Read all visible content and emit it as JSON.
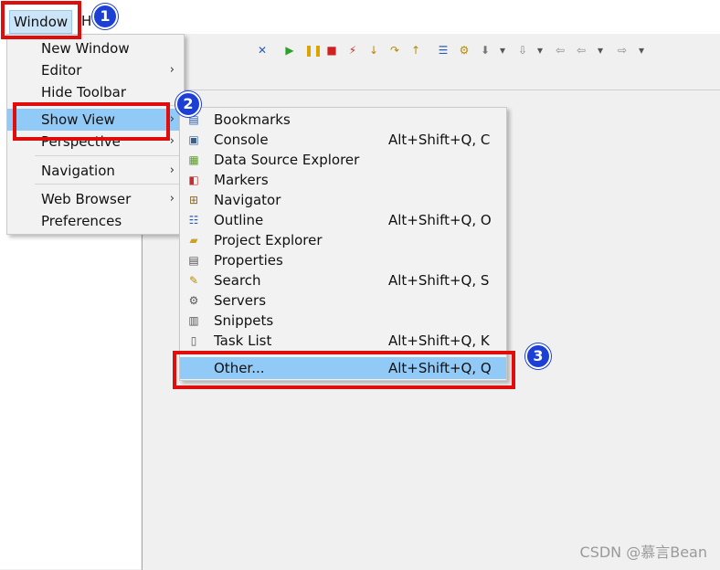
{
  "menubar": {
    "window": "Window",
    "help_partial": "H"
  },
  "window_menu": {
    "items": [
      {
        "label": "New Window"
      },
      {
        "label": "Editor",
        "submenu": true
      },
      {
        "label": "Hide Toolbar"
      },
      {
        "label": "Show View",
        "submenu": true,
        "highlighted": true
      },
      {
        "label": "Perspective",
        "submenu": true
      },
      {
        "label": "Navigation",
        "submenu": true
      },
      {
        "label": "Web Browser",
        "submenu": true
      },
      {
        "label": "Preferences"
      }
    ],
    "arrow": "›"
  },
  "show_view_menu": {
    "items": [
      {
        "label": "Bookmarks",
        "shortcut": "",
        "icon": "bookmarks-icon"
      },
      {
        "label": "Console",
        "shortcut": "Alt+Shift+Q, C",
        "icon": "console-icon"
      },
      {
        "label": "Data Source Explorer",
        "shortcut": "",
        "icon": "data-source-explorer-icon"
      },
      {
        "label": "Markers",
        "shortcut": "",
        "icon": "markers-icon"
      },
      {
        "label": "Navigator",
        "shortcut": "",
        "icon": "navigator-icon"
      },
      {
        "label": "Outline",
        "shortcut": "Alt+Shift+Q, O",
        "icon": "outline-icon"
      },
      {
        "label": "Project Explorer",
        "shortcut": "",
        "icon": "project-explorer-icon"
      },
      {
        "label": "Properties",
        "shortcut": "",
        "icon": "properties-icon"
      },
      {
        "label": "Search",
        "shortcut": "Alt+Shift+Q, S",
        "icon": "search-icon"
      },
      {
        "label": "Servers",
        "shortcut": "",
        "icon": "servers-icon"
      },
      {
        "label": "Snippets",
        "shortcut": "",
        "icon": "snippets-icon"
      },
      {
        "label": "Task List",
        "shortcut": "Alt+Shift+Q, K",
        "icon": "task-list-icon"
      },
      {
        "label": "Other...",
        "shortcut": "Alt+Shift+Q, Q",
        "highlighted": true
      }
    ]
  },
  "annotations": {
    "step1": "1",
    "step2": "2",
    "step3": "3",
    "color": "#e00d0d",
    "badge_color": "#1c3fd6"
  },
  "watermark": "CSDN @慕言Bean"
}
